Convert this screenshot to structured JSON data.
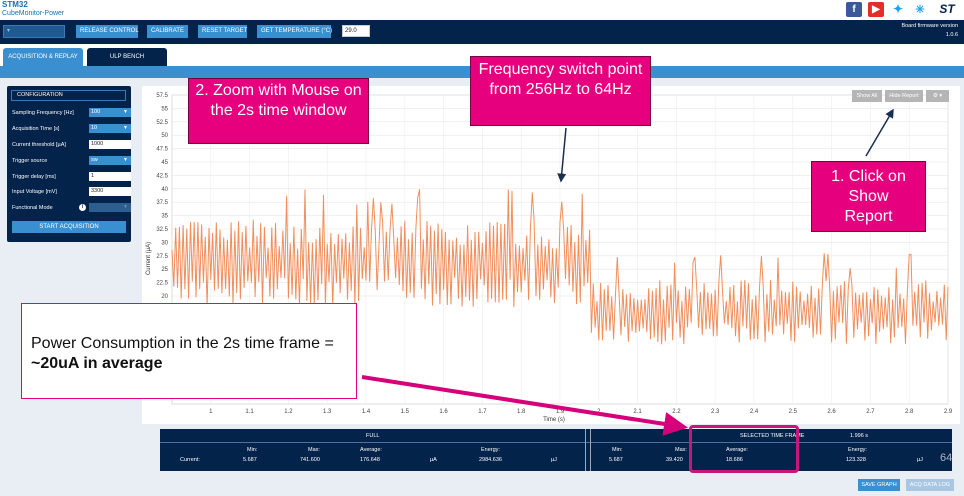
{
  "app": {
    "logo_line1": "STM32",
    "logo_line2": "CubeMonitor-Power",
    "firmware_label": "Board firmware version",
    "firmware_version": "1.0.6"
  },
  "toolbar": {
    "buttons": [
      "RELEASE CONTROL",
      "CALIBRATE",
      "RESET TARGET",
      "GET TEMPERATURE (°C)"
    ],
    "temperature_value": "29.0"
  },
  "tabs": [
    "ACQUISITION & REPLAY",
    "ULP BENCH"
  ],
  "config": {
    "title": "CONFIGURATION",
    "rows": [
      {
        "label": "Sampling Frequency [Hz]",
        "value": "100",
        "kind": "select"
      },
      {
        "label": "Acquisition Time [s]",
        "value": "10",
        "kind": "select"
      },
      {
        "label": "Current threshold [µA]",
        "value": "1000",
        "kind": "input"
      },
      {
        "label": "Trigger source",
        "value": "sw",
        "kind": "select"
      },
      {
        "label": "Trigger delay [ms]",
        "value": "1",
        "kind": "input"
      },
      {
        "label": "Input Voltage [mV]",
        "value": "3300",
        "kind": "input"
      },
      {
        "label": "Functional Mode",
        "value": "",
        "kind": "disabled"
      }
    ],
    "start_label": "START ACQUISITION"
  },
  "chart_controls": {
    "show_all": "Show All",
    "hide_report": "Hide Report"
  },
  "chart_data": {
    "type": "line",
    "xlabel": "Time (s)",
    "ylabel": "Current (µA)",
    "xlim": [
      0.9,
      2.9
    ],
    "ylim": [
      0,
      57.5
    ],
    "x_ticks": [
      1,
      1.1,
      1.2,
      1.3,
      1.4,
      1.5,
      1.6,
      1.7,
      1.8,
      1.9,
      2,
      2.1,
      2.2,
      2.3,
      2.4,
      2.5,
      2.6,
      2.7,
      2.8,
      2.9
    ],
    "y_ticks": [
      20,
      22.5,
      25,
      27.5,
      30,
      32.5,
      35,
      37.5,
      40,
      42.5,
      45,
      47.5,
      50,
      52.5,
      55,
      57.5
    ],
    "grid": true,
    "series_color": "#f28e5c",
    "switch_point_x": 1.98
  },
  "stats": {
    "full_label": "FULL",
    "selected_label": "SELECTED TIME FRAME",
    "selected_duration": "1.996 s",
    "row_label": "Current:",
    "full": {
      "min": "5.687",
      "max": "741.600",
      "average": "176.648",
      "current_unit": "µA",
      "energy": "2984.636",
      "energy_unit": "µJ"
    },
    "selected": {
      "min": "5.687",
      "max": "39.420",
      "average": "18.686",
      "energy": "123.328",
      "energy_unit": "µJ"
    },
    "col_headers": {
      "min": "Min:",
      "max": "Max:",
      "average": "Average:",
      "energy": "Energy:"
    }
  },
  "bottom_buttons": [
    "SAVE GRAPH",
    "ACQ DATA LOG"
  ],
  "annotations": {
    "zoom": "2. Zoom with Mouse on the 2s time window",
    "frequency": "Frequency switch point from 256Hz to 64Hz",
    "click": "1. Click on Show Report",
    "power_line1": "Power Consumption in the 2s time frame =",
    "power_bold": "~20uA in average"
  },
  "page_number": "64"
}
